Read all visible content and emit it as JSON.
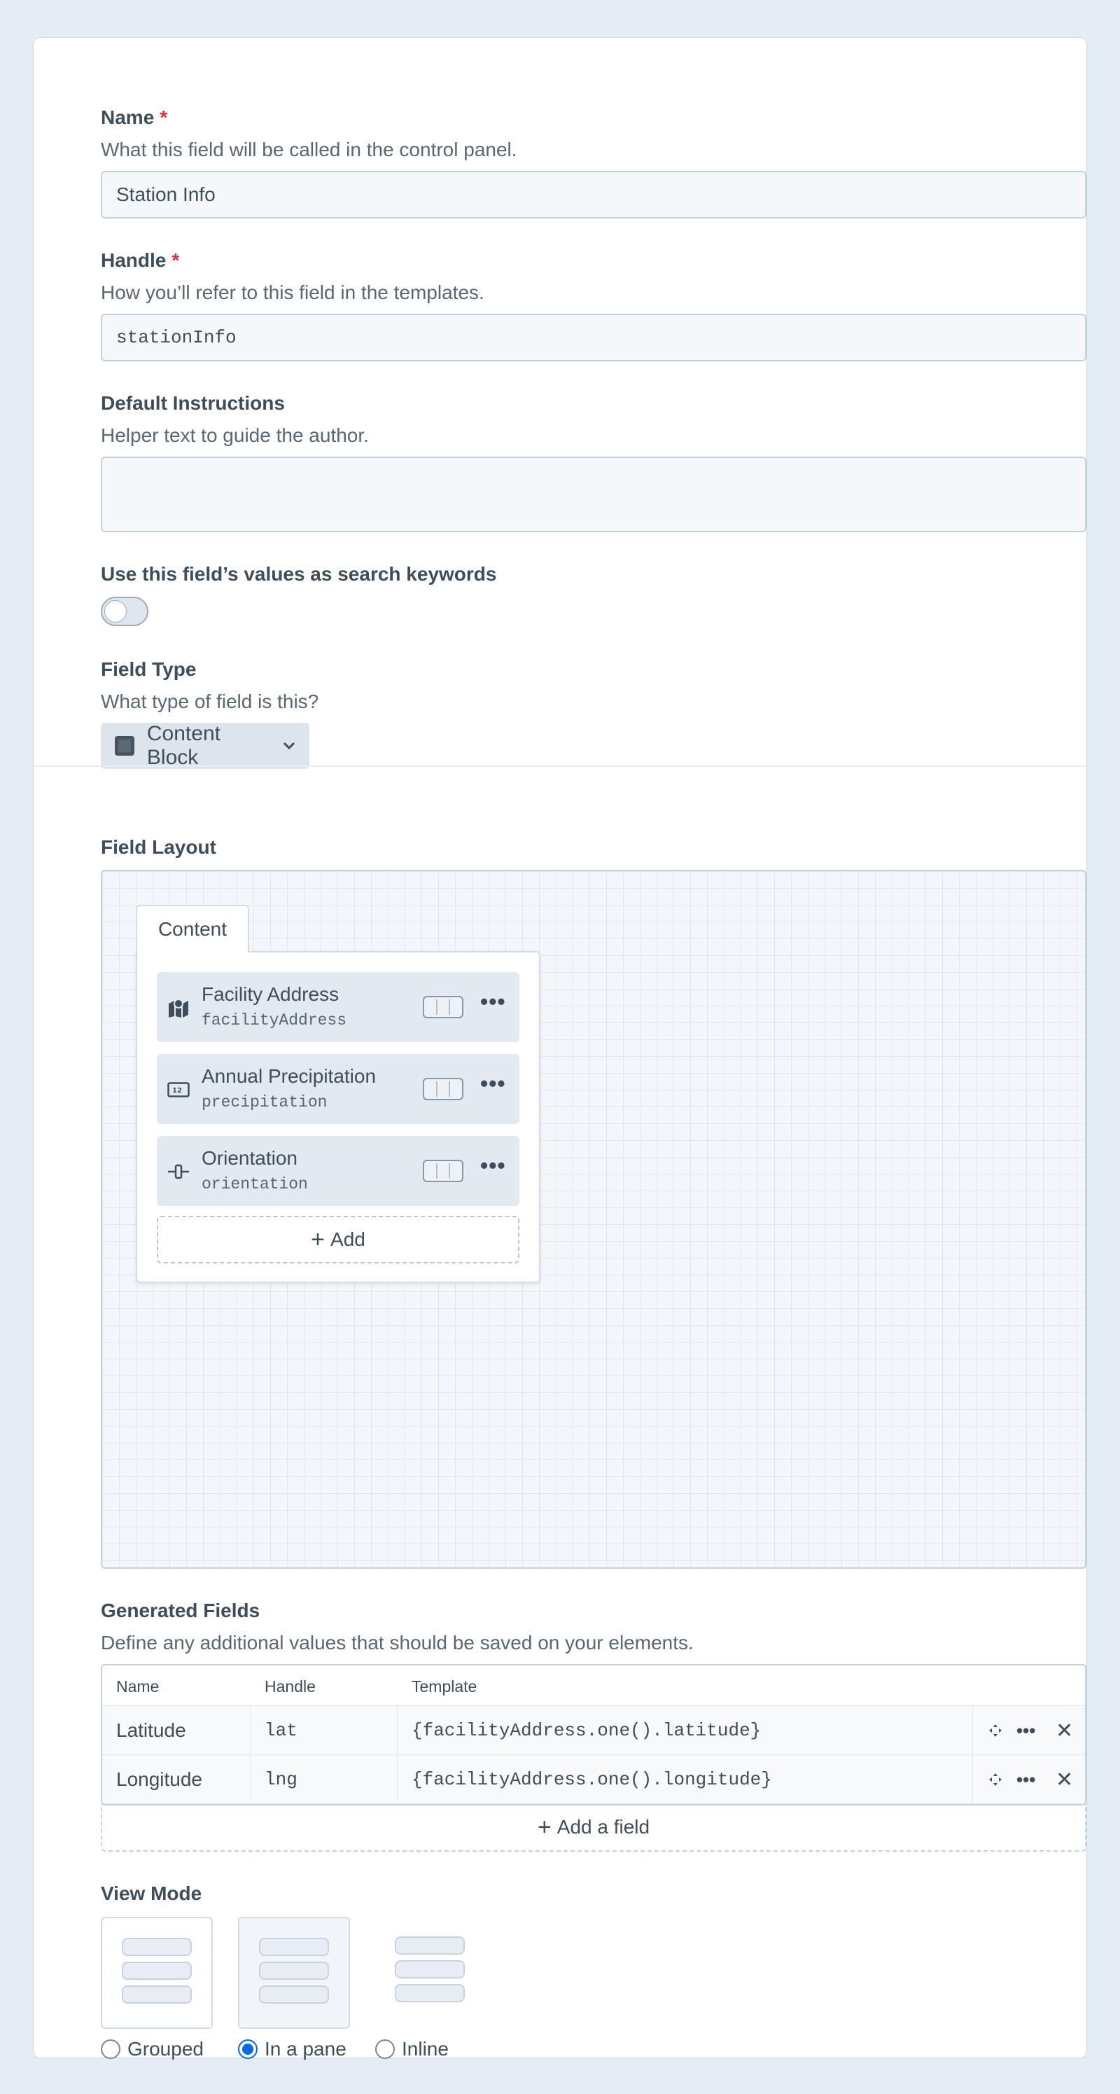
{
  "name": {
    "label": "Name",
    "required_mark": "*",
    "help": "What this field will be called in the control panel.",
    "value": "Station Info"
  },
  "handle": {
    "label": "Handle",
    "required_mark": "*",
    "help": "How you’ll refer to this field in the templates.",
    "value": "stationInfo"
  },
  "instructions": {
    "label": "Default Instructions",
    "help": "Helper text to guide the author.",
    "value": ""
  },
  "search_keywords": {
    "label": "Use this field’s values as search keywords",
    "enabled": false
  },
  "field_type": {
    "label": "Field Type",
    "help": "What type of field is this?",
    "value": "Content Block",
    "icon": "content-block-icon"
  },
  "field_layout": {
    "label": "Field Layout",
    "tab_label": "Content",
    "fields": [
      {
        "name": "Facility Address",
        "handle": "facilityAddress",
        "icon": "map-icon"
      },
      {
        "name": "Annual Precipitation",
        "handle": "precipitation",
        "icon": "number-icon"
      },
      {
        "name": "Orientation",
        "handle": "orientation",
        "icon": "slider-icon"
      }
    ],
    "add_label": "Add"
  },
  "generated_fields": {
    "label": "Generated Fields",
    "help": "Define any additional values that should be saved on your elements.",
    "columns": [
      "Name",
      "Handle",
      "Template"
    ],
    "rows": [
      {
        "name": "Latitude",
        "handle": "lat",
        "template": "{facilityAddress.one().latitude}"
      },
      {
        "name": "Longitude",
        "handle": "lng",
        "template": "{facilityAddress.one().longitude}"
      }
    ],
    "add_label": "Add a field"
  },
  "view_mode": {
    "label": "View Mode",
    "options": [
      "Grouped",
      "In a pane",
      "Inline"
    ],
    "selected": "In a pane"
  },
  "colors": {
    "accent": "#0b69e3",
    "required": "#e12d39"
  }
}
